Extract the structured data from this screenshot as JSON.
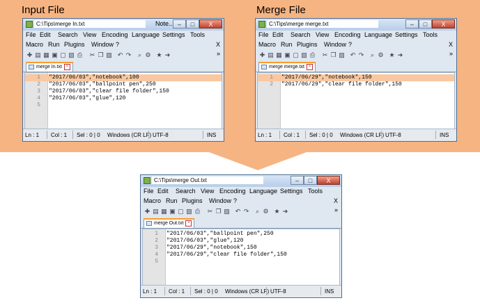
{
  "headings": {
    "input": "Input File",
    "merge": "Merge File"
  },
  "menu": [
    "File",
    "Edit",
    "Search",
    "View",
    "Encoding",
    "Language",
    "Settings",
    "Tools"
  ],
  "menu2": [
    "Macro",
    "Run",
    "Plugins",
    "Window",
    "?"
  ],
  "menu_close": "X",
  "toolbar_more": "»",
  "controls": {
    "min": "–",
    "max": "□",
    "close": "X"
  },
  "status": {
    "ln": "Ln : 1",
    "col": "Col : 1",
    "sel": "Sel : 0 | 0",
    "eol": "Windows (CR LF)",
    "enc": "UTF-8",
    "ins": "INS"
  },
  "windows": [
    {
      "id": "input",
      "title": "C:\\Tips\\merge In.txt",
      "title_extra": "Note...",
      "tab": "merge In.txt",
      "lines": [
        {
          "n": "1",
          "text": "\"2017/06/03\",\"notebook\",100",
          "hl": true
        },
        {
          "n": "2",
          "text": "\"2017/06/03\",\"ballpoint pen\",250"
        },
        {
          "n": "3",
          "text": "\"2017/06/03\",\"clear file folder\",150"
        },
        {
          "n": "4",
          "text": "\"2017/06/03\",\"glue\",120"
        },
        {
          "n": "5",
          "text": ""
        }
      ]
    },
    {
      "id": "merge",
      "title": "C:\\Tips\\merge merge.txt",
      "title_extra": "",
      "tab": "merge merge.txt",
      "lines": [
        {
          "n": "1",
          "text": "\"2017/06/29\",\"notebook\",150",
          "hl": true
        },
        {
          "n": "2",
          "text": "\"2017/06/29\",\"clear file folder\",150"
        }
      ]
    },
    {
      "id": "output",
      "title": "C:\\Tips\\merge Out.txt",
      "title_extra": "",
      "tab": "merge Out.txt",
      "lines": [
        {
          "n": "1",
          "text": "\"2017/06/03\",\"ballpoint pen\",250"
        },
        {
          "n": "2",
          "text": "\"2017/06/03\",\"glue\",120"
        },
        {
          "n": "3",
          "text": "\"2017/06/29\",\"notebook\",150"
        },
        {
          "n": "4",
          "text": "\"2017/06/29\",\"clear file folder\",150"
        },
        {
          "n": "5",
          "text": ""
        }
      ]
    }
  ]
}
